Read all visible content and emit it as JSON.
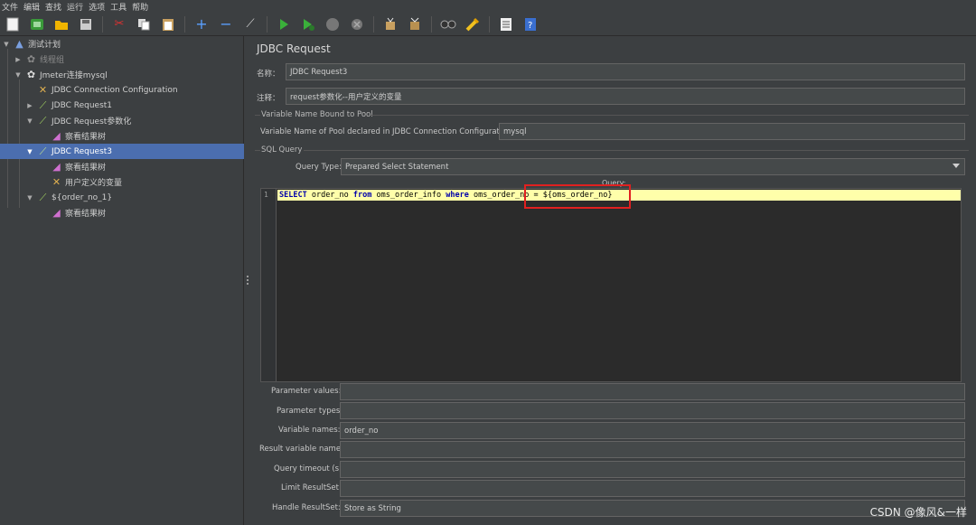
{
  "menu": [
    "文件",
    "编辑",
    "查找",
    "运行",
    "选项",
    "工具",
    "帮助"
  ],
  "toolbar": {
    "icons": [
      "new-icon",
      "templates-icon",
      "open-icon",
      "save-icon",
      "cut-icon",
      "copy-icon",
      "paste-icon",
      "expand-icon",
      "collapse-icon",
      "toggle-icon",
      "start-icon",
      "start-no-pause-icon",
      "stop-icon",
      "shutdown-icon",
      "clear-icon",
      "clear-all-icon",
      "search-icon",
      "reset-search-icon",
      "function-helper-icon",
      "help-icon"
    ]
  },
  "tree": {
    "items": [
      {
        "label": "测试计划"
      },
      {
        "label": "线程组"
      },
      {
        "label": "Jmeter连接mysql"
      },
      {
        "label": "JDBC Connection Configuration"
      },
      {
        "label": "JDBC Request1"
      },
      {
        "label": "JDBC Request参数化"
      },
      {
        "label": "察看结果树"
      },
      {
        "label": "JDBC Request3"
      },
      {
        "label": "察看结果树"
      },
      {
        "label": "用户定义的变量"
      },
      {
        "label": "${order_no_1}"
      },
      {
        "label": "察看结果树"
      }
    ]
  },
  "panel": {
    "title": "JDBC Request",
    "name_label": "名称：",
    "name_value": "JDBC Request3",
    "comment_label": "注释：",
    "comment_value": "request参数化--用户定义的变量",
    "pool_section": "Variable Name Bound to Pool",
    "pool_label": "Variable Name of Pool declared in JDBC Connection Configuration:",
    "pool_value": "mysql",
    "sql_section": "SQL Query",
    "query_type_label": "Query Type:",
    "query_type_value": "Prepared Select Statement",
    "query_label": "Query:",
    "line_number": "1",
    "code": {
      "kw1": "SELECT",
      "t1": " order_no ",
      "kw2": "from",
      "t2": " oms_order_info ",
      "kw3": "where",
      "t3": " oms_order_no = ${oms_order_no}"
    },
    "params": [
      {
        "label": "Parameter values:",
        "value": ""
      },
      {
        "label": "Parameter types:",
        "value": ""
      },
      {
        "label": "Variable names:",
        "value": "order_no"
      },
      {
        "label": "Result variable name:",
        "value": ""
      },
      {
        "label": "Query timeout (s):",
        "value": ""
      },
      {
        "label": "Limit ResultSet:",
        "value": ""
      },
      {
        "label": "Handle ResultSet:",
        "value": "Store as String"
      }
    ]
  },
  "watermark": "CSDN @像风&一样"
}
